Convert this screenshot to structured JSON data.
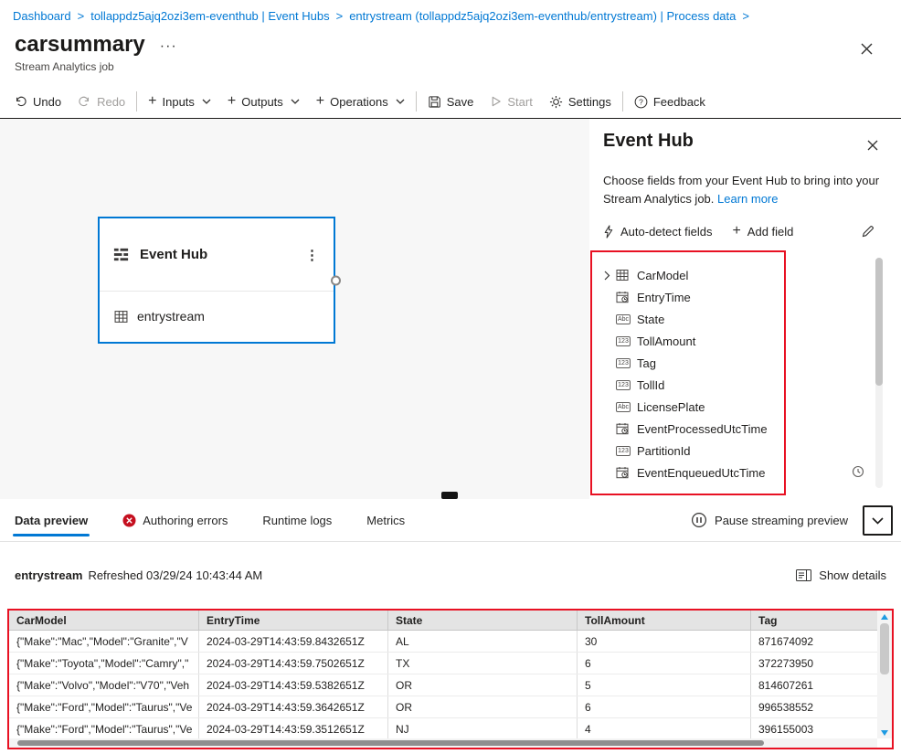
{
  "colors": {
    "accent": "#0078d4",
    "link": "#0078d4",
    "highlight": "#e81123",
    "error": "#c50f1f"
  },
  "icons": {
    "plus": "+",
    "ellipsis_v": "⋮"
  },
  "breadcrumb": {
    "separator": ">",
    "items": [
      "Dashboard",
      "tollappdz5ajq2ozi3em-eventhub | Event Hubs",
      "entrystream (tollappdz5ajq2ozi3em-eventhub/entrystream) | Process data"
    ]
  },
  "header": {
    "title": "carsummary",
    "more": "···",
    "subtitle": "Stream Analytics job"
  },
  "toolbar": {
    "undo": "Undo",
    "redo": "Redo",
    "inputs": "Inputs",
    "outputs": "Outputs",
    "operations": "Operations",
    "save": "Save",
    "start": "Start",
    "settings": "Settings",
    "feedback": "Feedback"
  },
  "node": {
    "title": "Event Hub",
    "stream": "entrystream"
  },
  "panel": {
    "title": "Event Hub",
    "description": "Choose fields from your Event Hub to bring into your Stream Analytics job.",
    "learn_more": "Learn more",
    "auto_detect": "Auto-detect fields",
    "add_field": "Add field",
    "badges": {
      "text": "Abc",
      "number": "123"
    },
    "fields": [
      {
        "name": "CarModel",
        "type": "record",
        "expandable": true
      },
      {
        "name": "EntryTime",
        "type": "datetime"
      },
      {
        "name": "State",
        "type": "text"
      },
      {
        "name": "TollAmount",
        "type": "number"
      },
      {
        "name": "Tag",
        "type": "number"
      },
      {
        "name": "TollId",
        "type": "number"
      },
      {
        "name": "LicensePlate",
        "type": "text"
      },
      {
        "name": "EventProcessedUtcTime",
        "type": "datetime"
      },
      {
        "name": "PartitionId",
        "type": "number"
      },
      {
        "name": "EventEnqueuedUtcTime",
        "type": "datetime"
      }
    ]
  },
  "tabs": {
    "items": [
      {
        "label": "Data preview",
        "active": true
      },
      {
        "label": "Authoring errors",
        "error": true
      },
      {
        "label": "Runtime logs"
      },
      {
        "label": "Metrics"
      }
    ],
    "pause": "Pause streaming preview"
  },
  "preview": {
    "stream": "entrystream",
    "refreshed": "Refreshed 03/29/24 10:43:44 AM",
    "show_details": "Show details"
  },
  "table": {
    "columns": [
      "CarModel",
      "EntryTime",
      "State",
      "TollAmount",
      "Tag"
    ],
    "rows": [
      [
        "{\"Make\":\"Mac\",\"Model\":\"Granite\",\"V",
        "2024-03-29T14:43:59.8432651Z",
        "AL",
        "30",
        "871674092"
      ],
      [
        "{\"Make\":\"Toyota\",\"Model\":\"Camry\",\"",
        "2024-03-29T14:43:59.7502651Z",
        "TX",
        "6",
        "372273950"
      ],
      [
        "{\"Make\":\"Volvo\",\"Model\":\"V70\",\"Veh",
        "2024-03-29T14:43:59.5382651Z",
        "OR",
        "5",
        "814607261"
      ],
      [
        "{\"Make\":\"Ford\",\"Model\":\"Taurus\",\"Ve",
        "2024-03-29T14:43:59.3642651Z",
        "OR",
        "6",
        "996538552"
      ],
      [
        "{\"Make\":\"Ford\",\"Model\":\"Taurus\",\"Ve",
        "2024-03-29T14:43:59.3512651Z",
        "NJ",
        "4",
        "396155003"
      ]
    ]
  }
}
